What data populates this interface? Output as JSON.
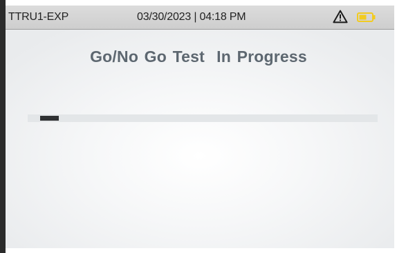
{
  "status_bar": {
    "device_name": "TTRU1-EXP",
    "datetime": "03/30/2023 | 04:18 PM",
    "warning_icon": "warning-triangle-icon",
    "battery_icon": "battery-icon",
    "battery_color": "#f2cb20"
  },
  "main": {
    "title": "Go/No Go Test  In Progress",
    "progress_fraction": 0.055
  },
  "colors": {
    "title_text": "#5d6770",
    "progress_fill": "#2f3133",
    "progress_track": "#e3e6e8",
    "status_bar_bg": "#d4d4d4"
  }
}
